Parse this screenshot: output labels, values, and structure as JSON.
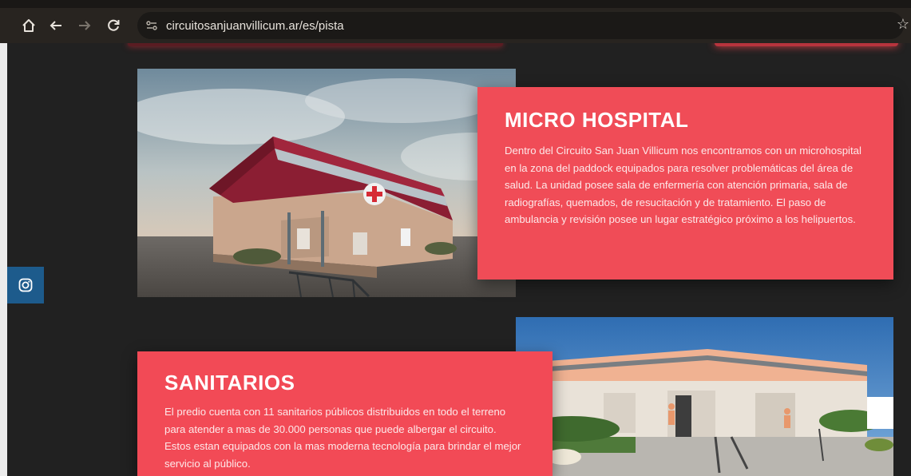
{
  "browser": {
    "url": "circuitosanjuanvillicum.ar/es/pista",
    "icons": {
      "home": "home-icon",
      "back": "back-arrow-icon",
      "forward": "forward-arrow-icon",
      "reload": "reload-icon",
      "site_info": "tune-icon",
      "bookmark": "star-icon"
    }
  },
  "social": {
    "instagram_icon": "instagram-icon",
    "color": "#1d5b8c"
  },
  "sections": [
    {
      "title": "MICRO HOSPITAL",
      "body": "Dentro del Circuito San Juan Villicum nos encontramos con un microhospital en la zona del paddock equipados para resolver problemáticas del área de salud. La unidad posee sala de enfermería con atención primaria, sala de radiografías, quemados, de resucitación y de tratamiento. El paso de ambulancia y revisión posee un lugar estratégico próximo a los helipuertos."
    },
    {
      "title": "SANITARIOS",
      "body": "El predio cuenta con 11 sanitarios públicos distribuidos en todo el terreno para atender a mas de 30.000 personas que puede albergar el circuito. Estos estan equipados con la mas moderna tecnología para brindar el mejor servicio al público."
    }
  ],
  "colors": {
    "card": "#f04c57",
    "page_bg": "#212121"
  }
}
